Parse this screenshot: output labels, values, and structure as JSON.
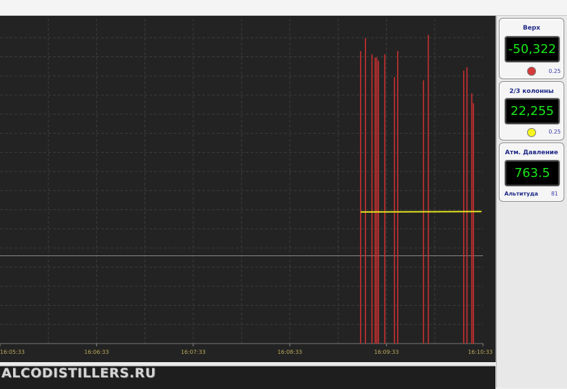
{
  "watermark": "ALCODISTILLERS.RU",
  "chart_data": {
    "type": "line",
    "x_ticks": [
      "16:05:33",
      "16:06:33",
      "16:07:33",
      "16:08:33",
      "16:09:33",
      "16:10:33"
    ],
    "grid": true,
    "series": [
      {
        "color": "#d03030",
        "style": "spikes",
        "spike_times": [
          "16:09:17",
          "16:09:20",
          "16:09:24",
          "16:09:26",
          "16:09:27",
          "16:09:28",
          "16:09:32",
          "16:09:38",
          "16:09:40",
          "16:09:56",
          "16:09:59",
          "16:10:21",
          "16:10:23",
          "16:10:26",
          "16:10:27"
        ],
        "spike_heights_pct": [
          90,
          94,
          89,
          88,
          88,
          87,
          89,
          82,
          90,
          81,
          95,
          84,
          85,
          77,
          74
        ]
      },
      {
        "color": "#e8e820",
        "style": "flat",
        "x_range": [
          "16:09:17",
          "16:10:32"
        ],
        "level_pct": 40.5
      }
    ],
    "reference_level_pct": 27
  },
  "panels": [
    {
      "title": "Верх",
      "value": "-50,322",
      "indicator_color": "#d43a3a",
      "step": "0.25"
    },
    {
      "title": "2/3 колонны",
      "value": "22,255",
      "indicator_color": "#f5f520",
      "step": "0.25"
    },
    {
      "title": "Атм. Давление",
      "value": "763.5",
      "sub_label": "Альтитуда",
      "sub_value": "81"
    }
  ]
}
